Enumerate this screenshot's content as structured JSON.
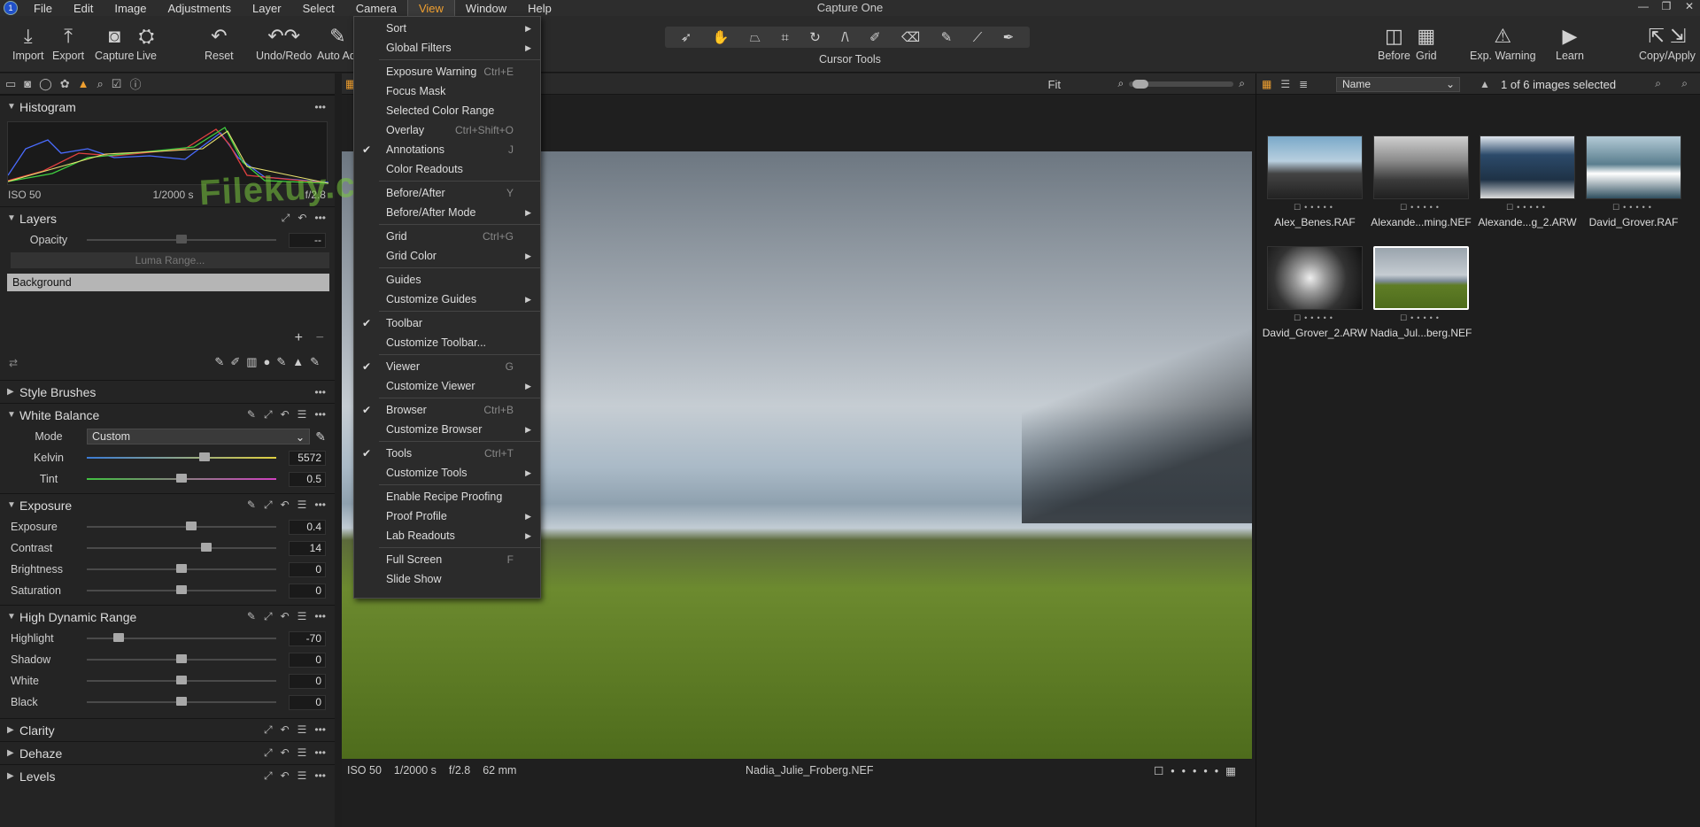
{
  "app": {
    "title": "Capture One"
  },
  "menubar": {
    "items": [
      "File",
      "Edit",
      "Image",
      "Adjustments",
      "Layer",
      "Select",
      "Camera",
      "View",
      "Window",
      "Help"
    ],
    "open_menu": "View"
  },
  "toolbar": {
    "left_buttons": [
      {
        "label": "Import",
        "icon": "import-icon",
        "glyph": "⤓"
      },
      {
        "label": "Export",
        "icon": "export-icon",
        "glyph": "⤒"
      },
      {
        "label": "Capture",
        "icon": "camera-icon",
        "glyph": "◙"
      },
      {
        "label": "Live",
        "icon": "live-icon",
        "glyph": "⛭"
      },
      {
        "label": "Reset",
        "icon": "reset-icon",
        "glyph": "↶"
      },
      {
        "label": "Undo/Redo",
        "icon": "undo-redo-icon",
        "glyph": "↶↷"
      },
      {
        "label": "Auto Adj",
        "icon": "auto-adjust-icon",
        "glyph": "✎"
      }
    ],
    "cursor_tools_label": "Cursor Tools",
    "cursor_tools": [
      "select",
      "pan",
      "keystone",
      "crop",
      "rotate",
      "straighten",
      "brush",
      "erase",
      "picker",
      "gradient",
      "pen"
    ],
    "right_buttons": [
      {
        "label": "Before",
        "icon": "before-icon",
        "glyph": "◫"
      },
      {
        "label": "Grid",
        "icon": "grid-icon",
        "glyph": "▦"
      },
      {
        "label": "Exp. Warning",
        "icon": "warning-icon",
        "glyph": "⚠"
      },
      {
        "label": "Learn",
        "icon": "learn-icon",
        "glyph": "▶"
      },
      {
        "label": "Copy/Apply",
        "icon": "copy-apply-icon",
        "glyph": "⇱ ⇲"
      }
    ]
  },
  "histogram": {
    "title": "Histogram",
    "iso": "ISO 50",
    "shutter": "1/2000 s",
    "aperture": "f/2.8"
  },
  "layers": {
    "title": "Layers",
    "opacity_label": "Opacity",
    "opacity_value": "--",
    "luma_button": "Luma Range...",
    "layer_name": "Background"
  },
  "style_brushes": {
    "title": "Style Brushes"
  },
  "white_balance": {
    "title": "White Balance",
    "mode_label": "Mode",
    "mode_value": "Custom",
    "kelvin_label": "Kelvin",
    "kelvin_value": "5572",
    "kelvin_level": 0.62,
    "tint_label": "Tint",
    "tint_value": "0.5",
    "tint_level": 0.5
  },
  "exposure": {
    "title": "Exposure",
    "rows": [
      {
        "label": "Exposure",
        "value": "0.4",
        "level": 0.55
      },
      {
        "label": "Contrast",
        "value": "14",
        "level": 0.63
      },
      {
        "label": "Brightness",
        "value": "0",
        "level": 0.5
      },
      {
        "label": "Saturation",
        "value": "0",
        "level": 0.5
      }
    ]
  },
  "hdr": {
    "title": "High Dynamic Range",
    "rows": [
      {
        "label": "Highlight",
        "value": "-70",
        "level": 0.17
      },
      {
        "label": "Shadow",
        "value": "0",
        "level": 0.5
      },
      {
        "label": "White",
        "value": "0",
        "level": 0.5
      },
      {
        "label": "Black",
        "value": "0",
        "level": 0.5
      }
    ]
  },
  "collapsed_sections": [
    "Clarity",
    "Dehaze",
    "Levels"
  ],
  "viewer": {
    "fit_label": "Fit",
    "status": {
      "iso": "ISO 50",
      "shutter": "1/2000 s",
      "aperture": "f/2.8",
      "focal": "62 mm",
      "filename": "Nadia_Julie_Froberg.NEF"
    }
  },
  "browser": {
    "sort_label": "Name",
    "selection_text": "1 of 6 images selected",
    "thumbs": [
      {
        "name": "Alex_Benes.RAF",
        "selected": false
      },
      {
        "name": "Alexande...ming.NEF",
        "selected": false
      },
      {
        "name": "Alexande...g_2.ARW",
        "selected": false
      },
      {
        "name": "David_Grover.RAF",
        "selected": false
      },
      {
        "name": "David_Grover_2.ARW",
        "selected": false
      },
      {
        "name": "Nadia_Jul...berg.NEF",
        "selected": true
      }
    ]
  },
  "view_menu": {
    "items": [
      {
        "label": "Sort",
        "submenu": true
      },
      {
        "label": "Global Filters",
        "submenu": true
      },
      {
        "sep": true
      },
      {
        "label": "Exposure Warning",
        "shortcut": "Ctrl+E"
      },
      {
        "label": "Focus Mask"
      },
      {
        "label": "Selected Color Range"
      },
      {
        "label": "Overlay",
        "shortcut": "Ctrl+Shift+O"
      },
      {
        "label": "Annotations",
        "shortcut": "J",
        "checked": true
      },
      {
        "label": "Color Readouts"
      },
      {
        "sep": true
      },
      {
        "label": "Before/After",
        "shortcut": "Y"
      },
      {
        "label": "Before/After Mode",
        "submenu": true
      },
      {
        "sep": true
      },
      {
        "label": "Grid",
        "shortcut": "Ctrl+G"
      },
      {
        "label": "Grid Color",
        "submenu": true
      },
      {
        "sep": true
      },
      {
        "label": "Guides"
      },
      {
        "label": "Customize Guides",
        "submenu": true
      },
      {
        "sep": true
      },
      {
        "label": "Toolbar",
        "checked": true
      },
      {
        "label": "Customize Toolbar..."
      },
      {
        "sep": true
      },
      {
        "label": "Viewer",
        "shortcut": "G",
        "checked": true
      },
      {
        "label": "Customize Viewer",
        "submenu": true
      },
      {
        "sep": true
      },
      {
        "label": "Browser",
        "shortcut": "Ctrl+B",
        "checked": true
      },
      {
        "label": "Customize Browser",
        "submenu": true
      },
      {
        "sep": true
      },
      {
        "label": "Tools",
        "shortcut": "Ctrl+T",
        "checked": true
      },
      {
        "label": "Customize Tools",
        "submenu": true
      },
      {
        "sep": true
      },
      {
        "label": "Enable Recipe Proofing"
      },
      {
        "label": "Proof Profile",
        "submenu": true
      },
      {
        "label": "Lab Readouts",
        "submenu": true
      },
      {
        "sep": true
      },
      {
        "label": "Full Screen",
        "shortcut": "F"
      },
      {
        "label": "Slide Show"
      }
    ]
  },
  "watermark": "Filekuy.com",
  "colors": {
    "accent": "#f0a030",
    "bg": "#1e1e1e",
    "panel": "#242424"
  }
}
